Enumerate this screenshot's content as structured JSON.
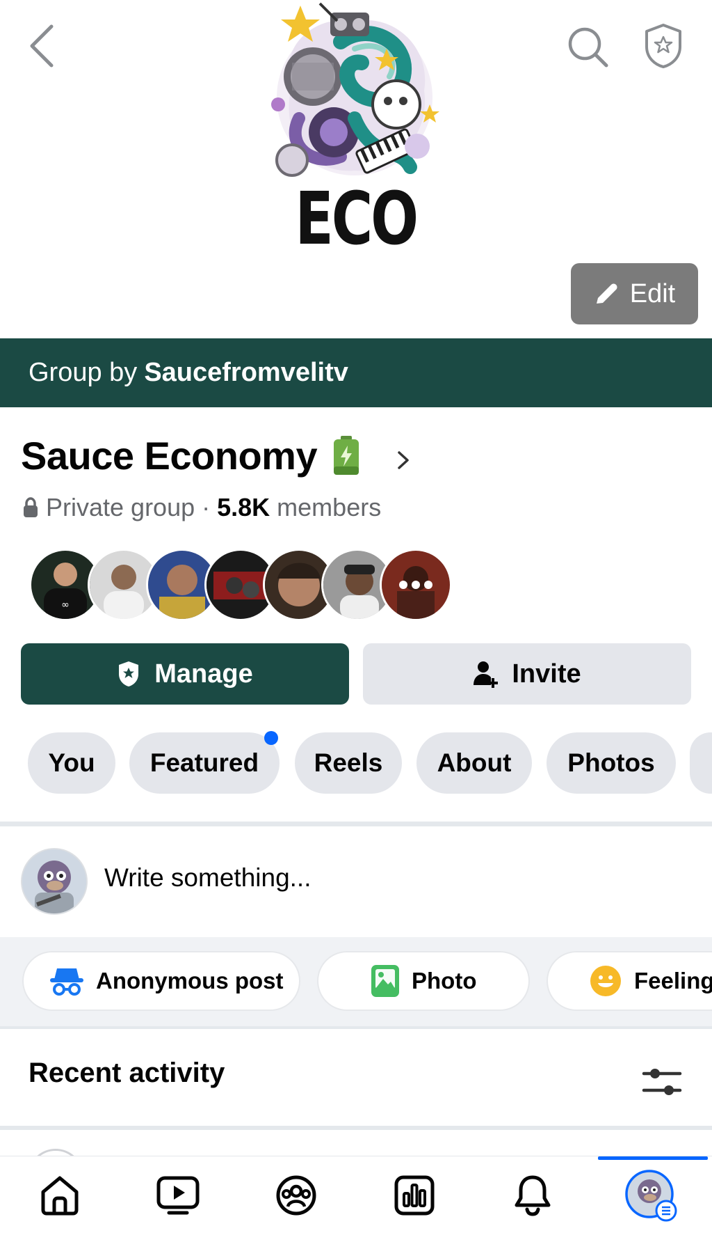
{
  "cover": {
    "logo_text": "ECO",
    "edit_label": "Edit",
    "icons": [
      "chevron-left-icon",
      "search-icon",
      "shield-star-icon",
      "pencil-icon"
    ]
  },
  "group_by": {
    "prefix": "Group by",
    "owner": "Saucefromvelitv"
  },
  "group": {
    "name": "Sauce Economy",
    "privacy": "Private group",
    "separator": "·",
    "member_count": "5.8K",
    "members_label": "members",
    "member_avatar_colors": [
      "#2b2b2b",
      "#c9c9c9",
      "#3b4a8c",
      "#8a1c1c",
      "#5c4637",
      "#6e6e6e",
      "#7a2a1e"
    ]
  },
  "actions": {
    "manage_label": "Manage",
    "invite_label": "Invite"
  },
  "tabs": [
    {
      "label": "You"
    },
    {
      "label": "Featured",
      "has_dot": true
    },
    {
      "label": "Reels"
    },
    {
      "label": "About"
    },
    {
      "label": "Photos"
    }
  ],
  "composer": {
    "placeholder": "Write something...",
    "chips": [
      {
        "label": "Anonymous post",
        "icon": "incognito-icon"
      },
      {
        "label": "Photo",
        "icon": "photo-icon"
      },
      {
        "label": "Feeling",
        "icon": "smiley-icon"
      }
    ]
  },
  "recent": {
    "title": "Recent activity"
  },
  "bottom_nav": {
    "items": [
      "home-icon",
      "video-icon",
      "groups-icon",
      "feeds-icon",
      "notifications-icon",
      "profile-menu-icon"
    ],
    "active_index": 5,
    "accent": "#0866ff"
  },
  "colors": {
    "brand_green": "#1b4a44",
    "chip_gray": "#e4e6eb",
    "secondary_text": "#65676b"
  }
}
